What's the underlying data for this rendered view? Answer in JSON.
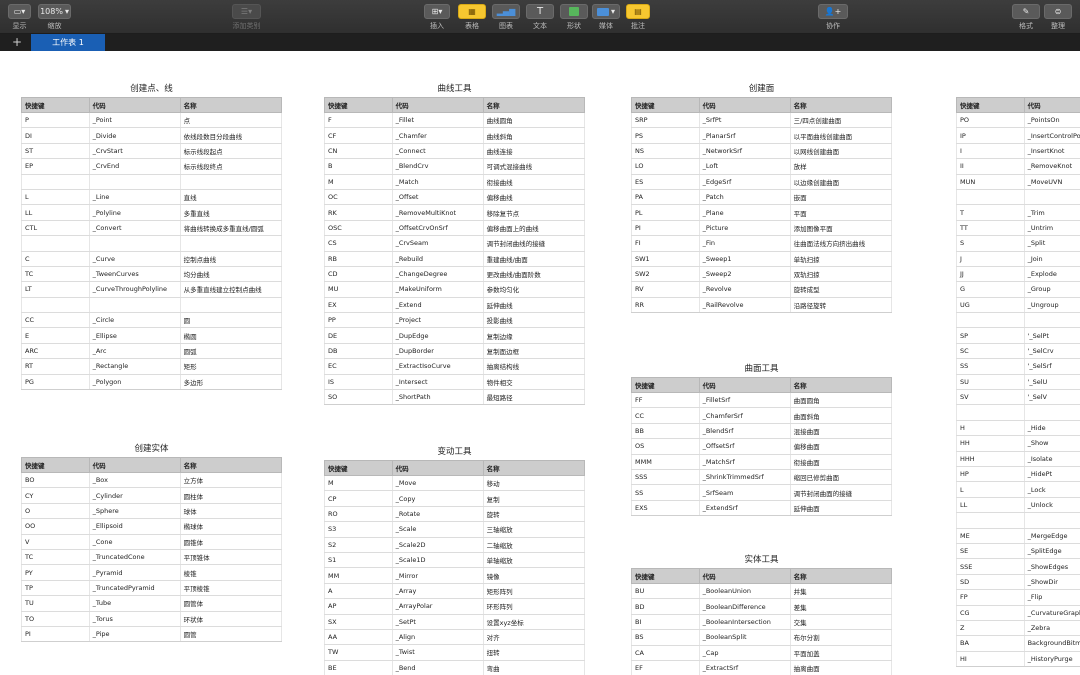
{
  "toolbar": {
    "left": [
      {
        "name": "view",
        "label": "显示",
        "icon": "sidebar-icon"
      },
      {
        "name": "zoom",
        "label": "缩放",
        "value": "108%"
      },
      {
        "name": "add-category",
        "label": "添加类别",
        "icon": "category-icon",
        "disabled": true
      }
    ],
    "center": [
      {
        "name": "insert",
        "label": "插入",
        "icon": "insert-icon"
      },
      {
        "name": "table",
        "label": "表格",
        "icon": "table-icon"
      },
      {
        "name": "chart",
        "label": "图表",
        "icon": "chart-icon"
      },
      {
        "name": "text",
        "label": "文本",
        "icon": "text-icon",
        "glyph": "T"
      },
      {
        "name": "shape",
        "label": "形状",
        "icon": "shape-icon"
      },
      {
        "name": "media",
        "label": "媒体",
        "icon": "media-icon"
      },
      {
        "name": "comment",
        "label": "批注",
        "icon": "comment-icon"
      }
    ],
    "collaborate": {
      "label": "协作",
      "icon": "collaborate-icon"
    },
    "right": [
      {
        "name": "format",
        "label": "格式",
        "icon": "brush-icon"
      },
      {
        "name": "organize",
        "label": "整理",
        "icon": "sort-icon"
      }
    ]
  },
  "tabs": {
    "add_symbol": "+",
    "sheet_name": "工作表 1"
  },
  "columns": [
    "快捷键",
    "代码",
    "名称"
  ],
  "tables": [
    {
      "id": "points-lines",
      "title": "创建点、线",
      "rows": [
        [
          "P",
          "_Point",
          "点"
        ],
        [
          "DI",
          "_Divide",
          "依线段数目分段曲线"
        ],
        [
          "ST",
          "_CrvStart",
          "标示线段起点"
        ],
        [
          "EP",
          "_CrvEnd",
          "标示线段终点"
        ],
        [
          "",
          "",
          ""
        ],
        [
          "L",
          "_Line",
          "直线"
        ],
        [
          "LL",
          "_Polyline",
          "多重直线"
        ],
        [
          "CTL",
          "_Convert",
          "将曲线转换成多重直线/圆弧"
        ],
        [
          "",
          "",
          ""
        ],
        [
          "C",
          "_Curve",
          "控制点曲线"
        ],
        [
          "TC",
          "_TweenCurves",
          "均分曲线"
        ],
        [
          "LT",
          "_CurveThroughPolyline",
          "从多重直线建立控制点曲线"
        ],
        [
          "",
          "",
          ""
        ],
        [
          "CC",
          "_Circle",
          "圆"
        ],
        [
          "E",
          "_Ellipse",
          "椭圆"
        ],
        [
          "ARC",
          "_Arc",
          "圆弧"
        ],
        [
          "RT",
          "_Rectangle",
          "矩形"
        ],
        [
          "PG",
          "_Polygon",
          "多边形"
        ]
      ]
    },
    {
      "id": "solids",
      "title": "创建实体",
      "rows": [
        [
          "BO",
          "_Box",
          "立方体"
        ],
        [
          "CY",
          "_Cylinder",
          "圆柱体"
        ],
        [
          "O",
          "_Sphere",
          "球体"
        ],
        [
          "OO",
          "_Ellipsoid",
          "椭球体"
        ],
        [
          "V",
          "_Cone",
          "圆锥体"
        ],
        [
          "TC",
          "_TruncatedCone",
          "平顶锥体"
        ],
        [
          "PY",
          "_Pyramid",
          "棱锥"
        ],
        [
          "TP",
          "_TruncatedPyramid",
          "平顶棱锥"
        ],
        [
          "TU",
          "_Tube",
          "圆管体"
        ],
        [
          "TO",
          "_Torus",
          "环状体"
        ],
        [
          "PI",
          "_Pipe",
          "圆管"
        ]
      ]
    },
    {
      "id": "curve-tools",
      "title": "曲线工具",
      "rows": [
        [
          "F",
          "_Fillet",
          "曲线圆角"
        ],
        [
          "CF",
          "_Chamfer",
          "曲线斜角"
        ],
        [
          "CN",
          "_Connect",
          "曲线连接"
        ],
        [
          "B",
          "_BlendCrv",
          "可调式混接曲线"
        ],
        [
          "M",
          "_Match",
          "衔接曲线"
        ],
        [
          "OC",
          "_Offset",
          "偏移曲线"
        ],
        [
          "RK",
          "_RemoveMultiKnot",
          "移除复节点"
        ],
        [
          "OSC",
          "_OffsetCrvOnSrf",
          "偏移曲面上的曲线"
        ],
        [
          "CS",
          "_CrvSeam",
          "调节封闭曲线的接缝"
        ],
        [
          "RB",
          "_Rebuild",
          "重建曲线/曲面"
        ],
        [
          "CD",
          "_ChangeDegree",
          "更改曲线/曲面阶数"
        ],
        [
          "MU",
          "_MakeUniform",
          "参数均匀化"
        ],
        [
          "EX",
          "_Extend",
          "延伸曲线"
        ],
        [
          "PP",
          "_Project",
          "投影曲线"
        ],
        [
          "DE",
          "_DupEdge",
          "复制边缘"
        ],
        [
          "DB",
          "_DupBorder",
          "复制面边框"
        ],
        [
          "EC",
          "_ExtractIsoCurve",
          "抽离结构线"
        ],
        [
          "IS",
          "_Intersect",
          "物件相交"
        ],
        [
          "SO",
          "_ShortPath",
          "最短路径"
        ]
      ]
    },
    {
      "id": "transform-tools",
      "title": "变动工具",
      "rows": [
        [
          "M",
          "_Move",
          "移动"
        ],
        [
          "CP",
          "_Copy",
          "复制"
        ],
        [
          "RO",
          "_Rotate",
          "旋转"
        ],
        [
          "S3",
          "_Scale",
          "三轴缩放"
        ],
        [
          "S2",
          "_Scale2D",
          "二轴缩放"
        ],
        [
          "S1",
          "_Scale1D",
          "单轴缩放"
        ],
        [
          "MM",
          "_Mirror",
          "镜像"
        ],
        [
          "A",
          "_Array",
          "矩形阵列"
        ],
        [
          "AP",
          "_ArrayPolar",
          "环形阵列"
        ],
        [
          "SX",
          "_SetPt",
          "设置xyz坐标"
        ],
        [
          "AA",
          "_Align",
          "对齐"
        ],
        [
          "TW",
          "_Twist",
          "扭转"
        ],
        [
          "BE",
          "_Bend",
          "弯曲"
        ]
      ]
    },
    {
      "id": "surfaces",
      "title": "创建面",
      "rows": [
        [
          "SRP",
          "_SrfPt",
          "三/四点创建曲面"
        ],
        [
          "PS",
          "_PlanarSrf",
          "以平面曲线创建曲面"
        ],
        [
          "NS",
          "_NetworkSrf",
          "以网线创建曲面"
        ],
        [
          "LO",
          "_Loft",
          "放样"
        ],
        [
          "ES",
          "_EdgeSrf",
          "以边缘创建曲面"
        ],
        [
          "PA",
          "_Patch",
          "嵌面"
        ],
        [
          "PL",
          "_Plane",
          "平面"
        ],
        [
          "PI",
          "_Picture",
          "添加图像平面"
        ],
        [
          "FI",
          "_Fin",
          "往曲面法线方向挤出曲线"
        ],
        [
          "SW1",
          "_Sweep1",
          "单轨扫掠"
        ],
        [
          "SW2",
          "_Sweep2",
          "双轨扫掠"
        ],
        [
          "RV",
          "_Revolve",
          "旋转成型"
        ],
        [
          "RR",
          "_RailRevolve",
          "沿路径旋转"
        ]
      ]
    },
    {
      "id": "surface-tools",
      "title": "曲面工具",
      "rows": [
        [
          "FF",
          "_FilletSrf",
          "曲面圆角"
        ],
        [
          "CC",
          "_ChamferSrf",
          "曲面斜角"
        ],
        [
          "BB",
          "_BlendSrf",
          "混接曲面"
        ],
        [
          "OS",
          "_OffsetSrf",
          "偏移曲面"
        ],
        [
          "MMM",
          "_MatchSrf",
          "衔接曲面"
        ],
        [
          "SSS",
          "_ShrinkTrimmedSrf",
          "缩回已修剪曲面"
        ],
        [
          "SS",
          "_SrfSeam",
          "调节封闭曲面的接缝"
        ],
        [
          "EXS",
          "_ExtendSrf",
          "延伸曲面"
        ]
      ]
    },
    {
      "id": "solid-tools",
      "title": "实体工具",
      "rows": [
        [
          "BU",
          "_BooleanUnion",
          "并集"
        ],
        [
          "BD",
          "_BooleanDifference",
          "差集"
        ],
        [
          "BI",
          "_BooleanIntersection",
          "交集"
        ],
        [
          "BS",
          "_BooleanSplit",
          "布尔分割"
        ],
        [
          "CA",
          "_Cap",
          "平面加盖"
        ],
        [
          "EF",
          "_ExtractSrf",
          "抽离曲面"
        ]
      ]
    },
    {
      "id": "edit-tools",
      "title": "编",
      "rows": [
        [
          "PO",
          "_PointsOn",
          ""
        ],
        [
          "IP",
          "_InsertControlPoi",
          ""
        ],
        [
          "I",
          "_InsertKnot",
          ""
        ],
        [
          "II",
          "_RemoveKnot",
          ""
        ],
        [
          "MUN",
          "_MoveUVN",
          ""
        ],
        [
          "",
          "",
          ""
        ],
        [
          "T",
          "_Trim",
          ""
        ],
        [
          "TT",
          "_Untrim",
          ""
        ],
        [
          "S",
          "_Split",
          ""
        ],
        [
          "J",
          "_Join",
          ""
        ],
        [
          "JJ",
          "_Explode",
          ""
        ],
        [
          "G",
          "_Group",
          ""
        ],
        [
          "UG",
          "_Ungroup",
          ""
        ],
        [
          "",
          "",
          ""
        ],
        [
          "SP",
          "'_SelPt",
          ""
        ],
        [
          "SC",
          "'_SelCrv",
          ""
        ],
        [
          "SS",
          "'_SelSrf",
          ""
        ],
        [
          "SU",
          "'_SelU",
          ""
        ],
        [
          "SV",
          "'_SelV",
          ""
        ],
        [
          "",
          "",
          ""
        ],
        [
          "H",
          "_Hide",
          ""
        ],
        [
          "HH",
          "_Show",
          ""
        ],
        [
          "HHH",
          "_Isolate",
          ""
        ],
        [
          "HP",
          "_HidePt",
          ""
        ],
        [
          "L",
          "_Lock",
          ""
        ],
        [
          "LL",
          "_Unlock",
          ""
        ],
        [
          "",
          "",
          ""
        ],
        [
          "ME",
          "_MergeEdge",
          ""
        ],
        [
          "SE",
          "_SplitEdge",
          ""
        ],
        [
          "SSE",
          "_ShowEdges",
          ""
        ],
        [
          "SD",
          "_ShowDir",
          ""
        ],
        [
          "FP",
          "_Flip",
          ""
        ],
        [
          "CG",
          "_CurvatureGraph",
          ""
        ],
        [
          "Z",
          "_Zebra",
          ""
        ],
        [
          "BA",
          "BackgroundBitm",
          ""
        ],
        [
          "HI",
          "_HistoryPurge",
          ""
        ]
      ]
    }
  ]
}
